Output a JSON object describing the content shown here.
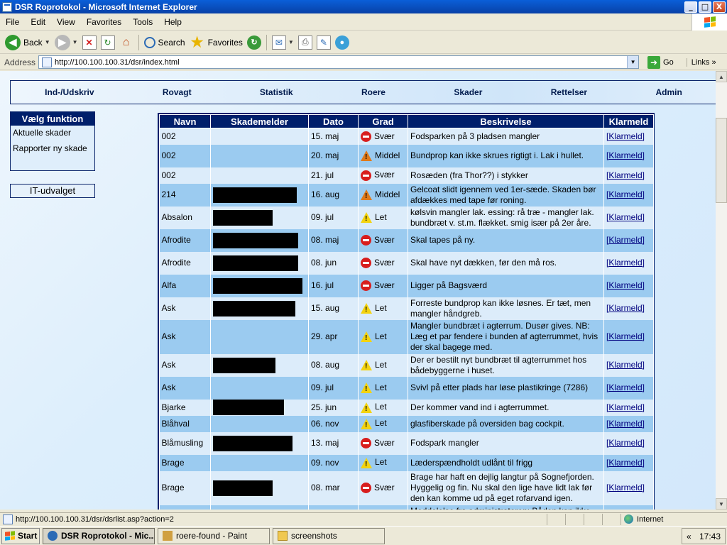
{
  "window": {
    "title": "DSR Roprotokol - Microsoft Internet Explorer",
    "minimize": "_",
    "maximize": "□",
    "close": "X"
  },
  "menubar": [
    "File",
    "Edit",
    "View",
    "Favorites",
    "Tools",
    "Help"
  ],
  "toolbar": {
    "back": "Back",
    "search": "Search",
    "favorites": "Favorites"
  },
  "address": {
    "label": "Address",
    "url": "http://100.100.100.31/dsr/index.html",
    "go": "Go",
    "links": "Links"
  },
  "topnav": [
    "Ind-/Udskriv",
    "Rovagt",
    "Statistik",
    "Roere",
    "Skader",
    "Rettelser",
    "Admin"
  ],
  "sidebar": {
    "title": "Vælg funktion",
    "links": [
      "Aktuelle skader",
      "Rapporter ny skade"
    ],
    "it_label": "IT-udvalget"
  },
  "table": {
    "headers": [
      "Navn",
      "Skademelder",
      "Dato",
      "Grad",
      "Beskrivelse",
      "Klarmeld"
    ],
    "rows": [
      {
        "navn": "002",
        "dato": "15. maj",
        "grad": "Svær",
        "icon": "svaer",
        "beskrivelse": "Fodsparken på 3 pladsen mangler",
        "klarmeld": "[Klarmeld]",
        "redacted": false,
        "redact_w": 0
      },
      {
        "navn": "002",
        "dato": "20. maj",
        "grad": "Middel",
        "icon": "middel",
        "beskrivelse": "Bundprop kan ikke skrues rigtigt i. Lak i hullet.",
        "klarmeld": "[Klarmeld]",
        "redacted": false,
        "redact_w": 0
      },
      {
        "navn": "002",
        "dato": "21. jul",
        "grad": "Svær",
        "icon": "svaer",
        "beskrivelse": "Rosæden (fra Thor??) i stykker",
        "klarmeld": "[Klarmeld]",
        "redacted": false,
        "redact_w": 0
      },
      {
        "navn": "214",
        "dato": "16. aug",
        "grad": "Middel",
        "icon": "middel",
        "beskrivelse": "Gelcoat slidt igennem ved 1er-sæde. Skaden bør afdækkes med tape før roning.",
        "klarmeld": "[Klarmeld]",
        "redacted": true,
        "redact_w": 118
      },
      {
        "navn": "Absalon",
        "dato": "09. jul",
        "grad": "Let",
        "icon": "let",
        "beskrivelse": "kølsvin mangler lak. essing: rå træ - mangler lak. bundbræt v. st.m. flækket. smig især på 2er åre.",
        "klarmeld": "[Klarmeld]",
        "redacted": true,
        "redact_w": 84
      },
      {
        "navn": "Afrodite",
        "dato": "08. maj",
        "grad": "Svær",
        "icon": "svaer",
        "beskrivelse": "Skal tapes på ny.",
        "klarmeld": "[Klarmeld]",
        "redacted": true,
        "redact_w": 120
      },
      {
        "navn": "Afrodite",
        "dato": "08. jun",
        "grad": "Svær",
        "icon": "svaer",
        "beskrivelse": "Skal have nyt dækken, før den må ros.",
        "klarmeld": "[Klarmeld]",
        "redacted": true,
        "redact_w": 120
      },
      {
        "navn": "Alfa",
        "dato": "16. jul",
        "grad": "Svær",
        "icon": "svaer",
        "beskrivelse": "Ligger på Bagsværd",
        "klarmeld": "[Klarmeld]",
        "redacted": true,
        "redact_w": 126
      },
      {
        "navn": "Ask",
        "dato": "15. aug",
        "grad": "Let",
        "icon": "let",
        "beskrivelse": "Forreste bundprop kan ikke løsnes. Er tæt, men mangler håndgreb.",
        "klarmeld": "[Klarmeld]",
        "redacted": true,
        "redact_w": 116
      },
      {
        "navn": "Ask",
        "dato": "29. apr",
        "grad": "Let",
        "icon": "let",
        "beskrivelse": "Mangler bundbræt i agterrum. Dusør gives. NB: Læg et par fendere i bunden af agterrummet, hvis der skal bagege med.",
        "klarmeld": "[Klarmeld]",
        "redacted": false,
        "redact_w": 0
      },
      {
        "navn": "Ask",
        "dato": "08. aug",
        "grad": "Let",
        "icon": "let",
        "beskrivelse": "Der er bestilt nyt bundbræt til agterrummet hos bådebyggerne i huset.",
        "klarmeld": "[Klarmeld]",
        "redacted": true,
        "redact_w": 88
      },
      {
        "navn": "Ask",
        "dato": "09. jul",
        "grad": "Let",
        "icon": "let",
        "beskrivelse": "Svivl på etter plads har løse plastikringe (7286)",
        "klarmeld": "[Klarmeld]",
        "redacted": false,
        "redact_w": 0
      },
      {
        "navn": "Bjarke",
        "dato": "25. jun",
        "grad": "Let",
        "icon": "let",
        "beskrivelse": "Der kommer vand ind i agterrummet.",
        "klarmeld": "[Klarmeld]",
        "redacted": true,
        "redact_w": 100
      },
      {
        "navn": "Blåhval",
        "dato": "06. nov",
        "grad": "Let",
        "icon": "let",
        "beskrivelse": "glasfiberskade på oversiden bag cockpit.",
        "klarmeld": "[Klarmeld]",
        "redacted": false,
        "redact_w": 0
      },
      {
        "navn": "Blåmusling",
        "dato": "13. maj",
        "grad": "Svær",
        "icon": "svaer",
        "beskrivelse": "Fodspark mangler",
        "klarmeld": "[Klarmeld]",
        "redacted": true,
        "redact_w": 112
      },
      {
        "navn": "Brage",
        "dato": "09. nov",
        "grad": "Let",
        "icon": "let",
        "beskrivelse": "Læderspændholdt udlånt til frigg",
        "klarmeld": "[Klarmeld]",
        "redacted": false,
        "redact_w": 0
      },
      {
        "navn": "Brage",
        "dato": "08. mar",
        "grad": "Svær",
        "icon": "svaer",
        "beskrivelse": "Brage har haft en dejlig langtur på Sognefjorden. Hyggelig og fin. Nu skal den lige have lidt lak før den kan komme ud på eget rofarvand igen.",
        "klarmeld": "[Klarmeld]",
        "redacted": true,
        "redact_w": 84
      },
      {
        "navn": "Dan",
        "dato": "",
        "grad": "Svær",
        "icon": "svaer",
        "beskrivelse": "Meddelelse fra administratoren: Båden kan ikke længere udlejes",
        "klarmeld": "[Klarmeld]",
        "redacted": false,
        "redact_w": 0
      }
    ]
  },
  "statusbar": {
    "url": "http://100.100.100.31/dsr/dsrlist.asp?action=2",
    "zone": "Internet"
  },
  "taskbar": {
    "start": "Start",
    "tasks": [
      "DSR Roprotokol - Mic...",
      "roere-found - Paint",
      "screenshots"
    ],
    "clock": "17:43",
    "tray_arrow": "«"
  }
}
